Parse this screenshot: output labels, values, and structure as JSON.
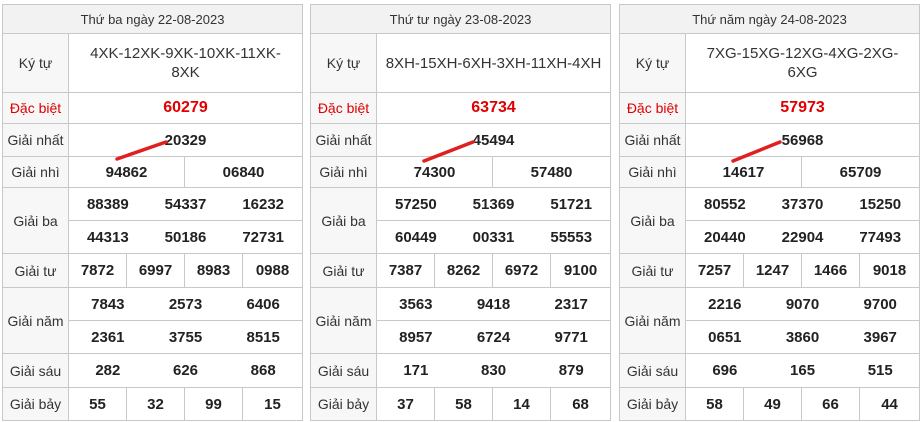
{
  "labels": {
    "kytu": "Ký tự",
    "dacbiet": "Đặc biệt",
    "g1": "Giải nhất",
    "g2": "Giải nhì",
    "g3": "Giải ba",
    "g4": "Giải tư",
    "g5": "Giải năm",
    "g6": "Giải sáu",
    "g7": "Giải bảy"
  },
  "colors": {
    "special": "#e00000",
    "border": "#c8c8c8",
    "header_bg": "#f2f2f2",
    "mark": "#e02020"
  },
  "panels": [
    {
      "date": "Thứ ba ngày 22-08-2023",
      "kytu": "4XK-12XK-9XK-10XK-11XK-8XK",
      "dacbiet": "60279",
      "g1": "20329",
      "g2": [
        "94862",
        "06840"
      ],
      "g3": [
        "88389",
        "54337",
        "16232",
        "44313",
        "50186",
        "72731"
      ],
      "g4": [
        "7872",
        "6997",
        "8983",
        "0988"
      ],
      "g5": [
        "7843",
        "2573",
        "6406",
        "2361",
        "3755",
        "8515"
      ],
      "g6": [
        "282",
        "626",
        "868"
      ],
      "g7": [
        "55",
        "32",
        "99",
        "15"
      ]
    },
    {
      "date": "Thứ tư ngày 23-08-2023",
      "kytu": "8XH-15XH-6XH-3XH-11XH-4XH",
      "dacbiet": "63734",
      "g1": "45494",
      "g2": [
        "74300",
        "57480"
      ],
      "g3": [
        "57250",
        "51369",
        "51721",
        "60449",
        "00331",
        "55553"
      ],
      "g4": [
        "7387",
        "8262",
        "6972",
        "9100"
      ],
      "g5": [
        "3563",
        "9418",
        "2317",
        "8957",
        "6724",
        "9771"
      ],
      "g6": [
        "171",
        "830",
        "879"
      ],
      "g7": [
        "37",
        "58",
        "14",
        "68"
      ]
    },
    {
      "date": "Thứ năm ngày 24-08-2023",
      "kytu": "7XG-15XG-12XG-4XG-2XG-6XG",
      "dacbiet": "57973",
      "g1": "56968",
      "g2": [
        "14617",
        "65709"
      ],
      "g3": [
        "80552",
        "37370",
        "15250",
        "20440",
        "22904",
        "77493"
      ],
      "g4": [
        "7257",
        "1247",
        "1466",
        "9018"
      ],
      "g5": [
        "2216",
        "9070",
        "9700",
        "0651",
        "3860",
        "3967"
      ],
      "g6": [
        "696",
        "165",
        "515"
      ],
      "g7": [
        "58",
        "49",
        "66",
        "44"
      ]
    }
  ]
}
